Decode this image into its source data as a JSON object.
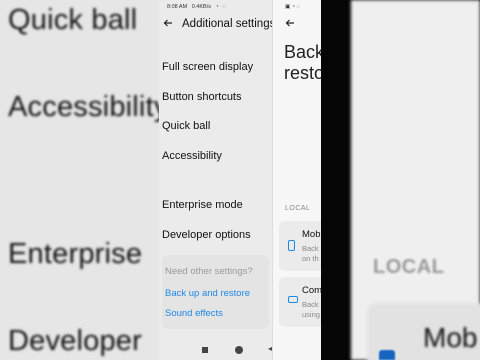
{
  "background_left": {
    "texts": [
      "Quick ball",
      "Accessibility",
      "Enterprise",
      "Developer"
    ]
  },
  "background_right": {
    "section_label": "LOCAL",
    "card_title": "Mob"
  },
  "main_screen": {
    "status": {
      "time": "8:08 AM",
      "speed": "0.4KB/s"
    },
    "header": {
      "back_icon": "back-arrow-icon",
      "title": "Additional settings"
    },
    "items": [
      {
        "label": "Full screen display"
      },
      {
        "label": "Button shortcuts"
      },
      {
        "label": "Quick ball"
      },
      {
        "label": "Accessibility"
      },
      {
        "label": "Enterprise mode"
      },
      {
        "label": "Developer options"
      }
    ],
    "footer": {
      "heading": "Need other settings?",
      "links": [
        "Back up and restore",
        "Sound effects"
      ]
    },
    "nav": {
      "recents_icon": "square-icon",
      "home_icon": "circle-icon",
      "back_icon": "triangle-back-icon"
    }
  },
  "second_screen": {
    "title_line1": "Back",
    "title_line2": "resto",
    "section_label": "LOCAL",
    "cards": [
      {
        "title": "Mob",
        "desc1": "Back",
        "desc2": "on th",
        "icon": "phone-icon"
      },
      {
        "title": "Com",
        "desc1": "Back",
        "desc2": "using",
        "icon": "computer-icon"
      }
    ]
  },
  "colors": {
    "accent": "#1e88e5",
    "screen_bg": "#ebebeb",
    "text": "#111111",
    "muted": "#999999"
  }
}
